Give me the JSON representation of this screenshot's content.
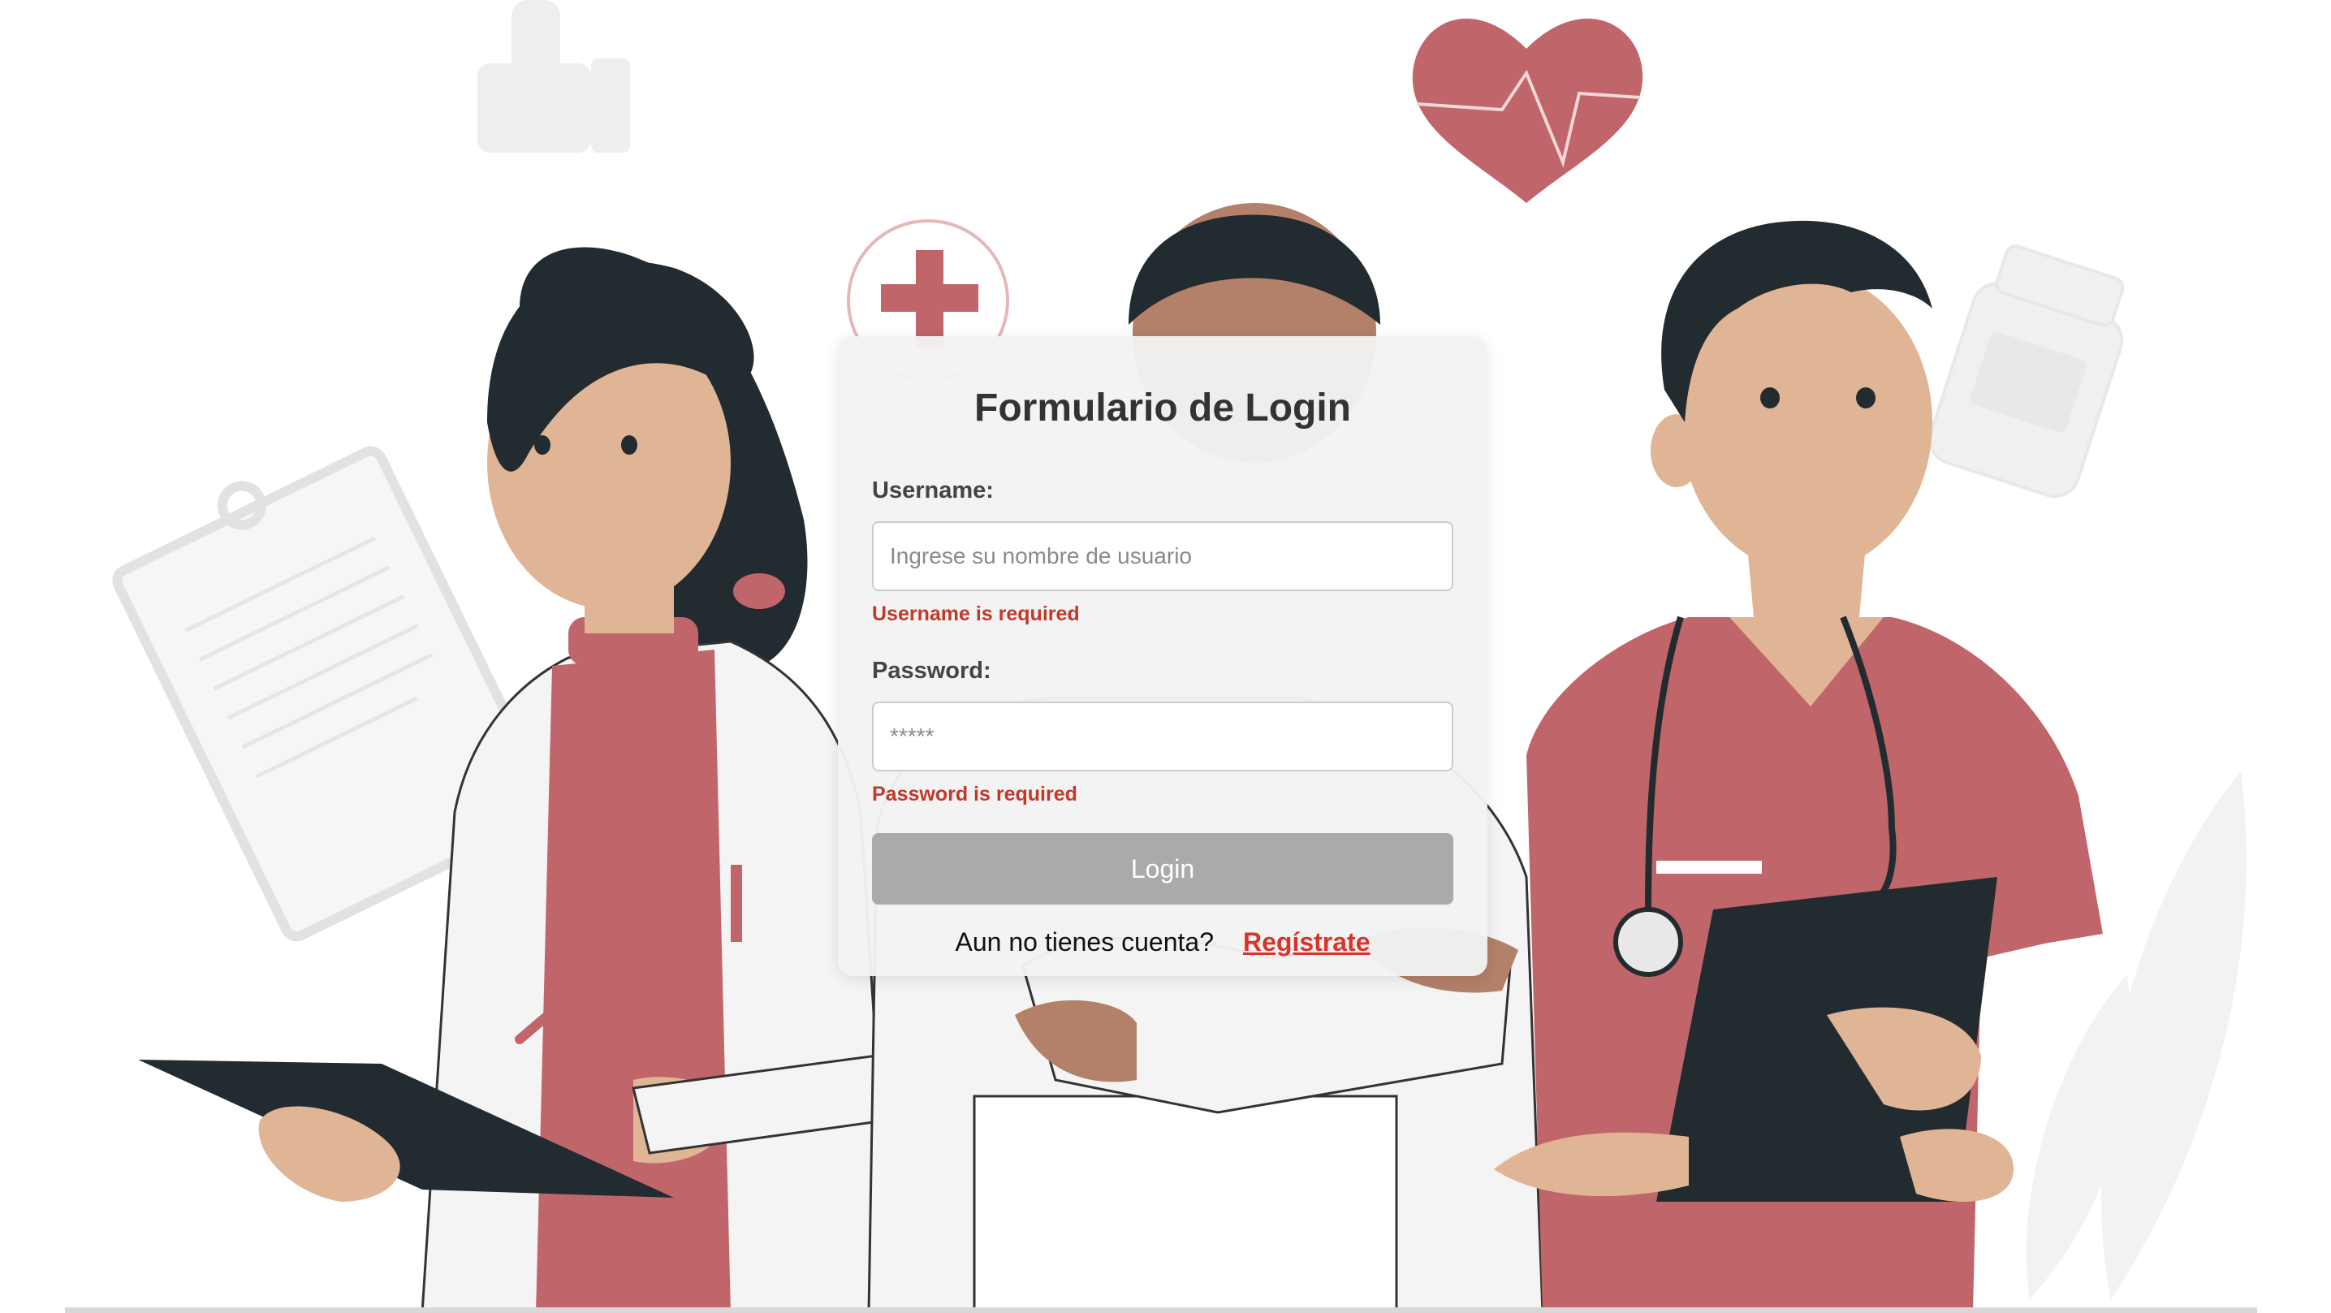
{
  "login_form": {
    "title": "Formulario de Login",
    "username_label": "Username:",
    "username_placeholder": "Ingrese su nombre de usuario",
    "username_value": "",
    "username_error": "Username is required",
    "password_label": "Password:",
    "password_placeholder": "*****",
    "password_value": "",
    "password_error": "Password is required",
    "submit_label": "Login",
    "register_prompt": "Aun no tienes cuenta?",
    "register_link": "Regístrate"
  },
  "colors": {
    "accent_red": "#c0656a",
    "dark_hair": "#222b2f",
    "error_red": "#c0392b",
    "link_red": "#d9332b",
    "button_gray": "#aaaaaa",
    "card_bg": "#f3f3f3"
  },
  "background_illustration": {
    "icons": [
      "thumbs-up-icon",
      "heart-pulse-icon",
      "medical-cross-icon",
      "clipboard-icon",
      "pill-bottle-icon",
      "leaf-icon",
      "stethoscope-icon"
    ],
    "figures": [
      "female-doctor",
      "male-doctor-arms-crossed",
      "male-nurse"
    ]
  }
}
